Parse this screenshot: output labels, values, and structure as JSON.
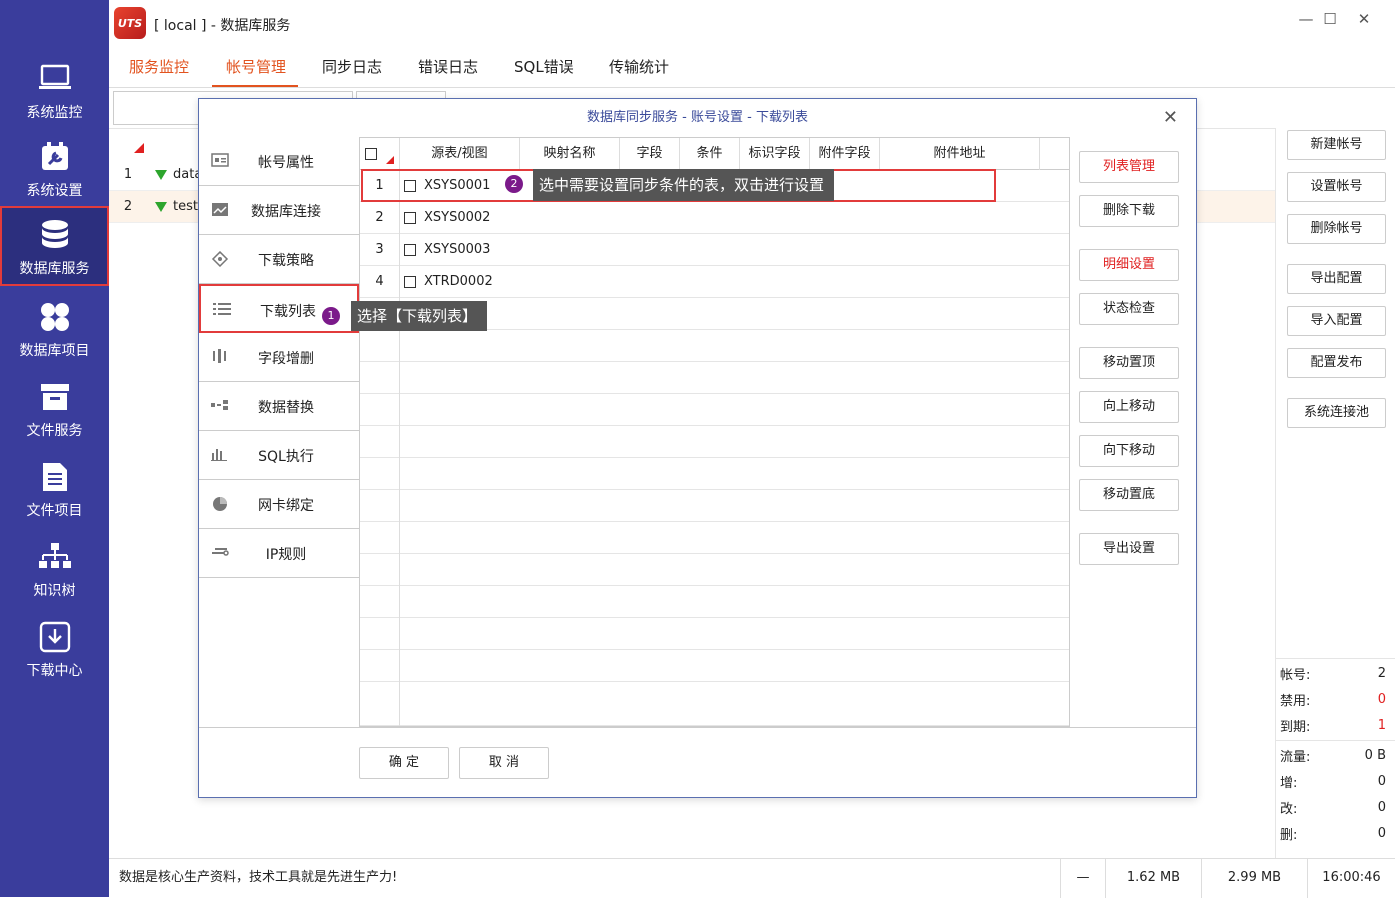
{
  "window": {
    "title": "[ local ] - 数据库服务",
    "logo_text": "UTS"
  },
  "sidebar": {
    "items": [
      {
        "label": "系统监控",
        "icon": "monitor-icon"
      },
      {
        "label": "系统设置",
        "icon": "settings-icon"
      },
      {
        "label": "数据库服务",
        "icon": "database-icon",
        "active": true
      },
      {
        "label": "数据库项目",
        "icon": "grid-icon"
      },
      {
        "label": "文件服务",
        "icon": "folder-icon"
      },
      {
        "label": "文件项目",
        "icon": "file-list-icon"
      },
      {
        "label": "知识树",
        "icon": "tree-icon"
      },
      {
        "label": "下载中心",
        "icon": "download-icon"
      }
    ]
  },
  "tabs": [
    "服务监控",
    "帐号管理",
    "同步日志",
    "错误日志",
    "SQL错误",
    "传输统计"
  ],
  "bg_table": {
    "rows": [
      {
        "num": "1",
        "name": "data"
      },
      {
        "num": "2",
        "name": "testa"
      }
    ]
  },
  "right_panel": {
    "buttons": [
      "新建帐号",
      "设置帐号",
      "删除帐号",
      "导出配置",
      "导入配置",
      "配置发布",
      "系统连接池"
    ],
    "stats": [
      {
        "label": "帐号:",
        "value": "2"
      },
      {
        "label": "禁用:",
        "value": "0"
      },
      {
        "label": "到期:",
        "value": "1"
      },
      {
        "label": "流量:",
        "value": "0 B"
      },
      {
        "label": "增:",
        "value": "0"
      },
      {
        "label": "改:",
        "value": "0"
      },
      {
        "label": "删:",
        "value": "0"
      }
    ]
  },
  "statusbar": {
    "message": "数据是核心生产资料，技术工具就是先进生产力!",
    "dash": "—",
    "mem1": "1.62 MB",
    "mem2": "2.99 MB",
    "time": "16:00:46"
  },
  "dialog": {
    "title": "数据库同步服务 - 账号设置 - 下载列表",
    "nav": [
      "帐号属性",
      "数据库连接",
      "下载策略",
      "下载列表",
      "字段增删",
      "数据替换",
      "SQL执行",
      "网卡绑定",
      "IP规则"
    ],
    "columns": [
      "源表/视图",
      "映射名称",
      "字段",
      "条件",
      "标识字段",
      "附件字段",
      "附件地址"
    ],
    "rows": [
      {
        "num": "1",
        "table": "XSYS0001"
      },
      {
        "num": "2",
        "table": "XSYS0002"
      },
      {
        "num": "3",
        "table": "XSYS0003"
      },
      {
        "num": "4",
        "table": "XTRD0002"
      }
    ],
    "actions": [
      "列表管理",
      "删除下载",
      "明细设置",
      "状态检查",
      "移动置顶",
      "向上移动",
      "向下移动",
      "移动置底",
      "导出设置"
    ],
    "ok": "确 定",
    "cancel": "取 消"
  },
  "annotations": {
    "tip1": {
      "num": "1",
      "text": "选择【下载列表】"
    },
    "tip2": {
      "num": "2",
      "text": "选中需要设置同步条件的表，双击进行设置"
    }
  },
  "colors": {
    "sidebar": "#3a3d9c",
    "accent": "#e2531f",
    "highlight": "#e23b3b",
    "badge": "#7b1a8a"
  }
}
